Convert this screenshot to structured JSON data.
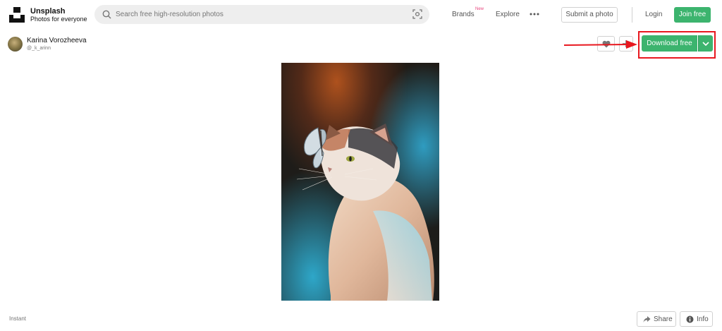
{
  "header": {
    "brand_name": "Unsplash",
    "brand_tagline": "Photos for everyone",
    "search_placeholder": "Search free high-resolution photos",
    "nav_brands": "Brands",
    "nav_brands_badge": "New",
    "nav_explore": "Explore",
    "submit_photo": "Submit a photo",
    "login": "Login",
    "join": "Join free"
  },
  "photo_header": {
    "author_name": "Karina Vorozheeva",
    "author_handle": "@_k_arinn",
    "download_label": "Download free"
  },
  "footer": {
    "instant": "Instant",
    "share": "Share",
    "info": "Info"
  },
  "colors": {
    "accent_green": "#3cb46e",
    "annotation_red": "#e8181f",
    "new_badge": "#e8457d"
  },
  "icons": [
    "unsplash-logo",
    "search-icon",
    "visual-search-icon",
    "more-icon",
    "heart-icon",
    "plus-icon",
    "chevron-down-icon",
    "share-icon",
    "info-icon",
    "red-arrow"
  ]
}
